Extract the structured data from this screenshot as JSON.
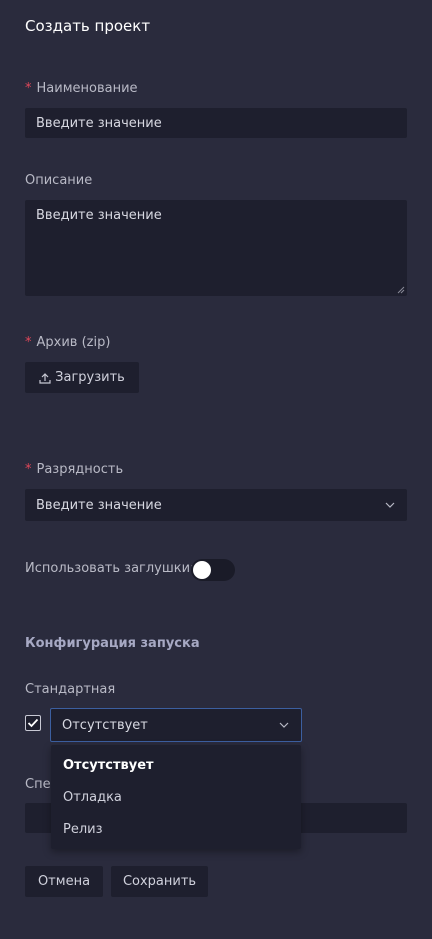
{
  "form": {
    "title": "Создать проект",
    "required_mark": "*",
    "name": {
      "label": "Наименование",
      "placeholder": "Введите значение"
    },
    "description": {
      "label": "Описание",
      "placeholder": "Введите значение"
    },
    "archive": {
      "label": "Архив (zip)",
      "upload_label": "Загрузить"
    },
    "bitness": {
      "label": "Разрядность",
      "placeholder": "Введите значение"
    },
    "stubs": {
      "label": "Использовать заглушки",
      "colon": ":",
      "enabled": false
    },
    "launch_config": {
      "section_title": "Конфигурация запуска",
      "standard_label": "Стандартная",
      "checked": true,
      "selected": "Отсутствует",
      "options": [
        "Отсутствует",
        "Отладка",
        "Релиз"
      ],
      "special_label_partial": "Спец"
    },
    "actions": {
      "cancel": "Отмена",
      "save": "Сохранить"
    }
  },
  "colors": {
    "background": "#2a2b3d",
    "field": "#1e1f2e",
    "required": "#e0475a",
    "focus_border": "#3c5fa0"
  }
}
